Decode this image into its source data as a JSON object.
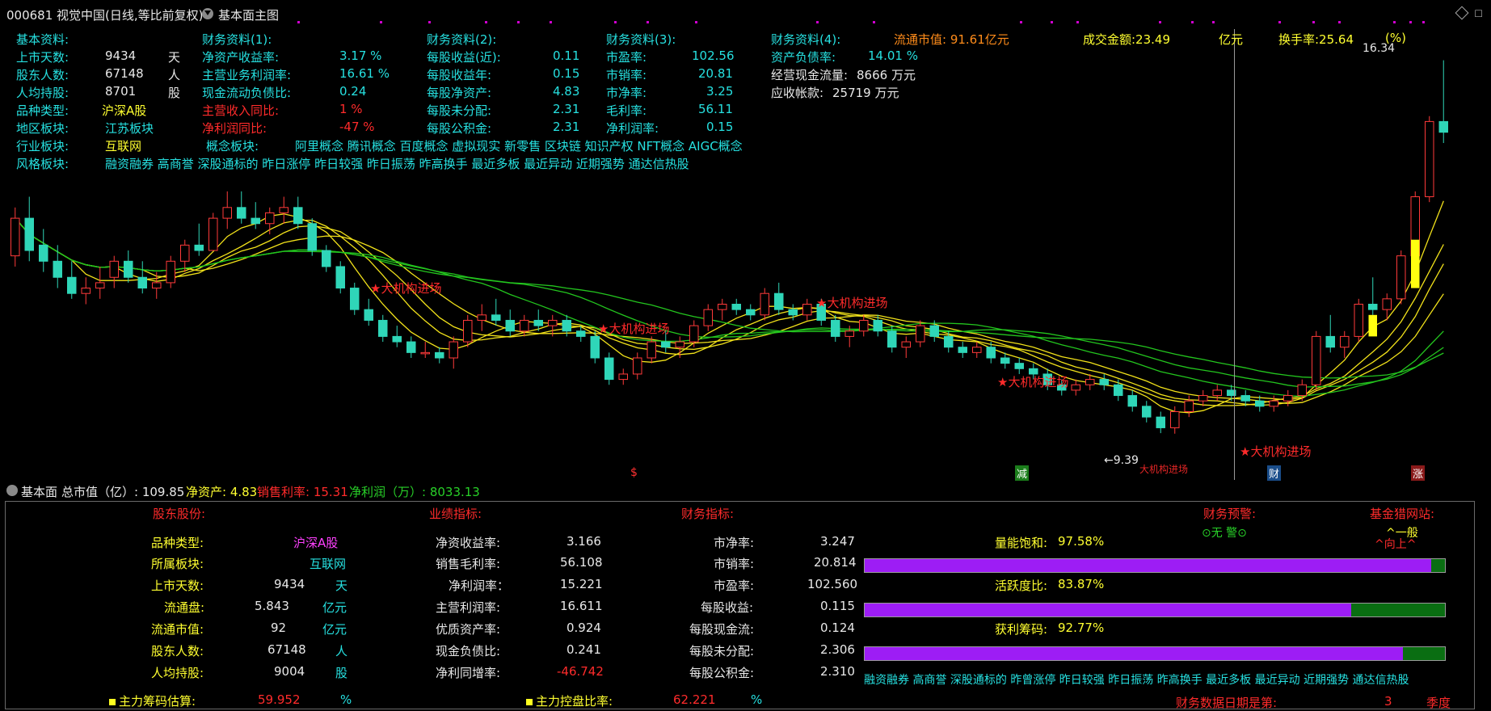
{
  "title": {
    "window_title": "000681 视觉中国(日线,等比前复权)",
    "chart_label": "基本面主图"
  },
  "info_block": {
    "col1": [
      {
        "label": "基本资料:",
        "value": "",
        "unit": ""
      },
      {
        "label": "上市天数:",
        "value": "9434",
        "unit": "天"
      },
      {
        "label": "股东人数:",
        "value": "67148",
        "unit": "人"
      },
      {
        "label": "人均持股:",
        "value": "8701",
        "unit": "股"
      },
      {
        "label": "品种类型:",
        "value": "沪深A股",
        "unit": ""
      },
      {
        "label": "地区板块:",
        "value": "江苏板块",
        "unit": ""
      },
      {
        "label": "行业板块:",
        "value": "互联网",
        "unit": ""
      },
      {
        "label": "风格板块:",
        "value": "融资融券 高商誉 深股通标的 昨日涨停 昨日较强 昨日振荡 昨高换手 最近多板 最近异动 近期强势 通达信热股",
        "unit": ""
      }
    ],
    "col2": [
      {
        "label": "财务资料(1):",
        "value": "",
        "unit": ""
      },
      {
        "label": "净资产收益率:",
        "value": "3.17 %",
        "unit": ""
      },
      {
        "label": "主营业务利润率:",
        "value": "16.61 %",
        "unit": ""
      },
      {
        "label": "现金流动负债比:",
        "value": "0.24",
        "unit": ""
      },
      {
        "label": "主营收入同比:",
        "value": "1 %",
        "unit": ""
      },
      {
        "label": "净利润同比:",
        "value": "-47 %",
        "unit": ""
      },
      {
        "label": "概念板块:",
        "value": "阿里概念 腾讯概念 百度概念 虚拟现实 新零售 区块链 知识产权 NFT概念 AIGC概念",
        "unit": ""
      }
    ],
    "col3": [
      {
        "label": "财务资料(2):",
        "value": ""
      },
      {
        "label": "每股收益(近):",
        "value": "0.11"
      },
      {
        "label": "每股收益年:",
        "value": "0.15"
      },
      {
        "label": "每股净资产:",
        "value": "4.83"
      },
      {
        "label": "每股未分配:",
        "value": "2.31"
      },
      {
        "label": "每股公积金:",
        "value": "2.31"
      }
    ],
    "col4": [
      {
        "label": "财务资料(3):",
        "value": ""
      },
      {
        "label": "市盈率:",
        "value": "102.56"
      },
      {
        "label": "市销率:",
        "value": "20.81"
      },
      {
        "label": "市净率:",
        "value": "3.25"
      },
      {
        "label": "毛利率:",
        "value": "56.11"
      },
      {
        "label": "净利润率:",
        "value": "0.15"
      }
    ],
    "col5": [
      {
        "label": "财务资料(4):",
        "value": ""
      },
      {
        "label": "资产负债率:",
        "value": "14.01 %"
      },
      {
        "label": "经营现金流量:",
        "value": "8666 万元"
      },
      {
        "label": "应收帐款:",
        "value": "25719 万元"
      }
    ],
    "market_cap": "流通市值: 91.61亿元",
    "turnover_amount": "成交金额:23.49",
    "turnover_unit": "亿元",
    "turnover_rate": "换手率:25.64",
    "turnover_rate_unit": "(%)"
  },
  "chart_annotations": {
    "signal_label": "★大机构进场",
    "high_price": "16.34",
    "low_price": "←9.39",
    "low_tag": "大机构进场",
    "event_markers": [
      "$",
      "减",
      "财",
      "涨"
    ]
  },
  "chart_data": {
    "type": "candlestick",
    "y_range": [
      8.8,
      16.8
    ],
    "ohlc": [
      [
        12.7,
        13.6,
        12.5,
        13.4
      ],
      [
        13.4,
        13.8,
        12.6,
        12.8
      ],
      [
        12.9,
        13.2,
        12.4,
        12.6
      ],
      [
        12.6,
        12.9,
        12.1,
        12.3
      ],
      [
        12.3,
        12.6,
        11.9,
        12.0
      ],
      [
        12.0,
        12.3,
        11.8,
        12.1
      ],
      [
        12.1,
        12.5,
        11.9,
        12.2
      ],
      [
        12.3,
        12.7,
        12.1,
        12.6
      ],
      [
        12.6,
        12.8,
        12.2,
        12.3
      ],
      [
        12.3,
        12.6,
        12.0,
        12.1
      ],
      [
        12.1,
        12.4,
        11.9,
        12.2
      ],
      [
        12.2,
        12.7,
        12.1,
        12.6
      ],
      [
        12.6,
        13.0,
        12.4,
        12.9
      ],
      [
        12.9,
        13.3,
        12.7,
        12.8
      ],
      [
        12.8,
        13.5,
        12.8,
        13.4
      ],
      [
        13.4,
        13.9,
        13.2,
        13.6
      ],
      [
        13.6,
        13.9,
        13.3,
        13.4
      ],
      [
        13.4,
        13.7,
        13.2,
        13.3
      ],
      [
        13.3,
        13.6,
        13.1,
        13.5
      ],
      [
        13.5,
        13.8,
        13.3,
        13.6
      ],
      [
        13.6,
        13.8,
        13.2,
        13.3
      ],
      [
        13.3,
        13.4,
        12.7,
        12.8
      ],
      [
        12.8,
        12.9,
        12.4,
        12.5
      ],
      [
        12.5,
        12.6,
        12.0,
        12.1
      ],
      [
        12.1,
        12.2,
        11.6,
        11.7
      ],
      [
        11.7,
        11.9,
        11.4,
        11.5
      ],
      [
        11.5,
        11.6,
        11.1,
        11.2
      ],
      [
        11.2,
        11.4,
        11.0,
        11.1
      ],
      [
        11.1,
        11.2,
        10.8,
        10.9
      ],
      [
        10.9,
        11.1,
        10.8,
        10.9
      ],
      [
        10.9,
        11.0,
        10.7,
        10.8
      ],
      [
        10.8,
        11.2,
        10.6,
        11.1
      ],
      [
        11.1,
        11.6,
        11.0,
        11.5
      ],
      [
        11.5,
        11.8,
        11.3,
        11.6
      ],
      [
        11.6,
        11.9,
        11.4,
        11.5
      ],
      [
        11.5,
        11.7,
        11.2,
        11.3
      ],
      [
        11.3,
        11.6,
        11.2,
        11.5
      ],
      [
        11.5,
        11.7,
        11.3,
        11.4
      ],
      [
        11.4,
        11.6,
        11.2,
        11.5
      ],
      [
        11.5,
        11.6,
        11.2,
        11.3
      ],
      [
        11.3,
        11.4,
        11.1,
        11.2
      ],
      [
        11.2,
        11.3,
        10.7,
        10.8
      ],
      [
        10.8,
        10.9,
        10.3,
        10.4
      ],
      [
        10.4,
        10.6,
        10.3,
        10.5
      ],
      [
        10.5,
        10.9,
        10.4,
        10.8
      ],
      [
        10.8,
        11.2,
        10.7,
        11.1
      ],
      [
        11.1,
        11.3,
        10.9,
        11.0
      ],
      [
        11.0,
        11.2,
        10.8,
        11.1
      ],
      [
        11.1,
        11.5,
        11.0,
        11.4
      ],
      [
        11.4,
        11.8,
        11.3,
        11.7
      ],
      [
        11.7,
        11.9,
        11.5,
        11.8
      ],
      [
        11.8,
        11.9,
        11.6,
        11.7
      ],
      [
        11.7,
        11.8,
        11.5,
        11.6
      ],
      [
        11.6,
        12.1,
        11.5,
        12.0
      ],
      [
        12.0,
        12.2,
        11.6,
        11.7
      ],
      [
        11.7,
        11.8,
        11.5,
        11.6
      ],
      [
        11.6,
        11.9,
        11.5,
        11.8
      ],
      [
        11.8,
        11.9,
        11.4,
        11.5
      ],
      [
        11.5,
        11.6,
        11.1,
        11.2
      ],
      [
        11.2,
        11.4,
        11.0,
        11.3
      ],
      [
        11.3,
        11.6,
        11.2,
        11.5
      ],
      [
        11.5,
        11.6,
        11.2,
        11.3
      ],
      [
        11.3,
        11.4,
        10.9,
        11.0
      ],
      [
        11.0,
        11.2,
        10.8,
        11.1
      ],
      [
        11.1,
        11.5,
        11.0,
        11.4
      ],
      [
        11.4,
        11.5,
        11.1,
        11.2
      ],
      [
        11.2,
        11.3,
        10.9,
        11.0
      ],
      [
        11.0,
        11.1,
        10.8,
        10.9
      ],
      [
        10.9,
        11.1,
        10.8,
        11.0
      ],
      [
        11.0,
        11.1,
        10.7,
        10.8
      ],
      [
        10.8,
        10.9,
        10.6,
        10.7
      ],
      [
        10.7,
        10.8,
        10.5,
        10.6
      ],
      [
        10.6,
        10.7,
        10.4,
        10.5
      ],
      [
        10.5,
        10.6,
        10.2,
        10.3
      ],
      [
        10.3,
        10.4,
        10.1,
        10.2
      ],
      [
        10.2,
        10.4,
        10.1,
        10.3
      ],
      [
        10.3,
        10.5,
        10.2,
        10.4
      ],
      [
        10.4,
        10.5,
        10.2,
        10.3
      ],
      [
        10.3,
        10.4,
        10.0,
        10.1
      ],
      [
        10.1,
        10.2,
        9.8,
        9.9
      ],
      [
        9.9,
        10.0,
        9.6,
        9.7
      ],
      [
        9.7,
        9.8,
        9.4,
        9.5
      ],
      [
        9.5,
        9.9,
        9.39,
        9.8
      ],
      [
        9.8,
        10.1,
        9.7,
        10.0
      ],
      [
        10.0,
        10.2,
        9.9,
        10.1
      ],
      [
        10.1,
        10.3,
        10.0,
        10.2
      ],
      [
        10.2,
        10.3,
        10.0,
        10.1
      ],
      [
        10.1,
        10.2,
        9.9,
        10.0
      ],
      [
        10.0,
        10.1,
        9.8,
        9.9
      ],
      [
        9.9,
        10.1,
        9.8,
        10.0
      ],
      [
        10.0,
        10.2,
        9.9,
        10.1
      ],
      [
        10.1,
        10.4,
        10.0,
        10.3
      ],
      [
        10.3,
        11.3,
        10.2,
        11.2
      ],
      [
        11.2,
        11.6,
        10.9,
        11.0
      ],
      [
        11.0,
        11.3,
        10.8,
        11.2
      ],
      [
        11.2,
        11.9,
        11.1,
        11.8
      ],
      [
        11.8,
        12.3,
        11.6,
        11.7
      ],
      [
        11.7,
        12.0,
        11.5,
        11.9
      ],
      [
        11.9,
        12.8,
        11.8,
        12.7
      ],
      [
        12.7,
        13.9,
        12.6,
        13.8
      ],
      [
        13.8,
        15.3,
        13.7,
        15.2
      ],
      [
        15.2,
        16.34,
        14.8,
        15.0
      ]
    ],
    "ma_series": [
      "MA5",
      "MA10",
      "MA20",
      "MA30",
      "MA60",
      "MA90",
      "MA120"
    ]
  },
  "sub_header": {
    "label": "基本面",
    "total_cap": "总市值（亿）: 109.85",
    "net_assets": "净资产: 4.83",
    "net_margin": "销售利率: 15.31",
    "net_profit": "净利润（万）: 8033.13"
  },
  "fund_panel": {
    "section_headers": [
      "股东股份:",
      "业绩指标:",
      "财务指标:",
      "财务预警:",
      "基金猎网站:"
    ],
    "shareholder_rows": [
      {
        "label": "品种类型:",
        "value": "沪深A股",
        "unit": ""
      },
      {
        "label": "所属板块:",
        "value": "互联网",
        "unit": ""
      },
      {
        "label": "上市天数:",
        "value": "9434",
        "unit": "天"
      },
      {
        "label": "流通盘:",
        "value": "5.843",
        "unit": "亿元"
      },
      {
        "label": "流通市值:",
        "value": "92",
        "unit": "亿元"
      },
      {
        "label": "股东人数:",
        "value": "67148",
        "unit": "人"
      },
      {
        "label": "人均持股:",
        "value": "9004",
        "unit": "股"
      }
    ],
    "performance_rows": [
      {
        "label": "净资收益率:",
        "value": "3.166"
      },
      {
        "label": "销售毛利率:",
        "value": "56.108"
      },
      {
        "label": "净利润率：",
        "value": "15.221"
      },
      {
        "label": "主营利润率:",
        "value": "16.611"
      },
      {
        "label": "优质资产率:",
        "value": "0.924"
      },
      {
        "label": "现金负债比:",
        "value": "0.241"
      },
      {
        "label": "净利同增率:",
        "value": "-46.742"
      }
    ],
    "finance_rows": [
      {
        "label": "市净率:",
        "value": "3.247"
      },
      {
        "label": "市销率:",
        "value": "20.814"
      },
      {
        "label": "市盈率:",
        "value": "102.560"
      },
      {
        "label": "每股收益:",
        "value": "0.115"
      },
      {
        "label": "每股现金流:",
        "value": "0.124"
      },
      {
        "label": "每股未分配:",
        "value": "2.306"
      },
      {
        "label": "每股公积金:",
        "value": "2.310"
      }
    ],
    "warning": "⊙无 警⊙",
    "rating_line1": "^一般",
    "rating_line2": "^向上^",
    "bars": [
      {
        "label": "量能饱和:",
        "value": "97.58%",
        "fraction": 0.9758
      },
      {
        "label": "活跃度比:",
        "value": "83.87%",
        "fraction": 0.8387
      },
      {
        "label": "获利筹码:",
        "value": "92.77%",
        "fraction": 0.9277
      }
    ],
    "style_tags": "融资融券 高商誉 深股通标的 昨曾涨停 昨日较强 昨日振荡 昨高换手 最近多板 最近异动 近期强势 通达信热股",
    "main_chip_label": "主力筹码估算:",
    "main_chip_value": "59.952",
    "main_chip_unit": "%",
    "control_label": "主力控盘比率:",
    "control_value": "62.221",
    "control_unit": "%",
    "report_label": "财务数据日期是第:",
    "report_value": "3",
    "report_unit": "季度"
  },
  "colors": {
    "up": "#ff3a3a",
    "down": "#2fd6b8",
    "ma_yellow": "#f2e21a",
    "ma_green": "#23c51e",
    "bar_purple": "#9d1df5",
    "bar_green": "#0a6e12"
  }
}
